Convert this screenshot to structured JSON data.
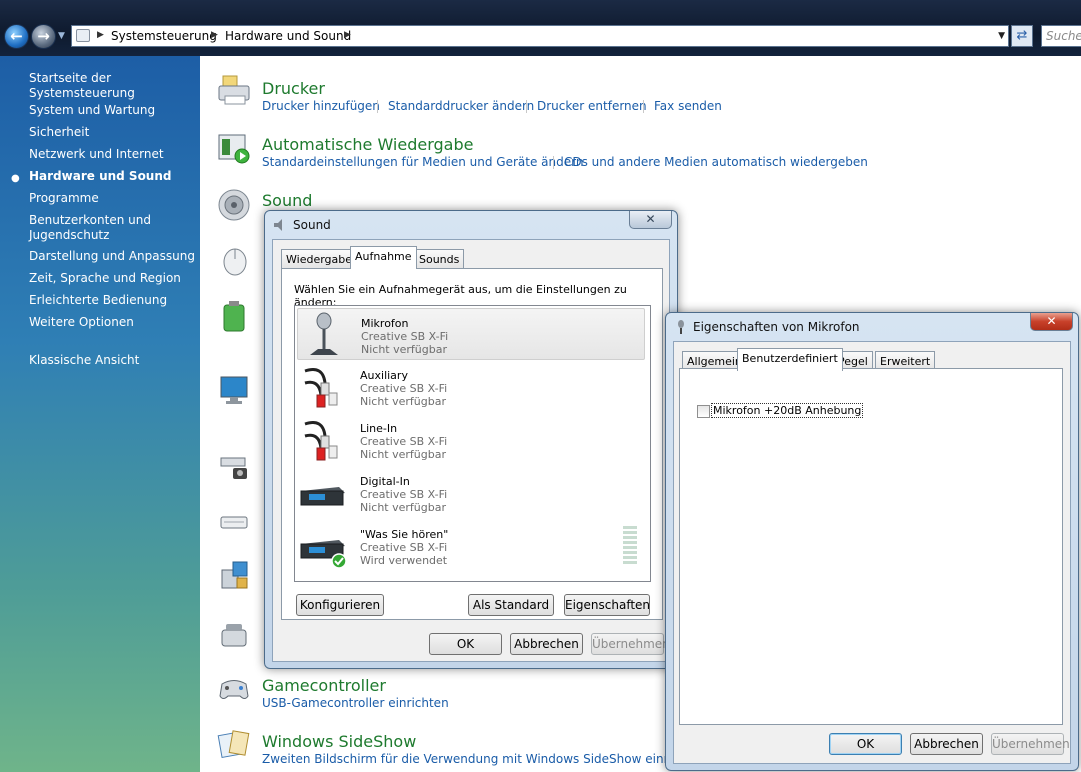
{
  "explorer": {
    "breadcrumb": [
      "Systemsteuerung",
      "Hardware und Sound"
    ],
    "search_placeholder": "Suchen"
  },
  "sidebar": {
    "items": [
      {
        "label": "Startseite der Systemsteuerung"
      },
      {
        "label": "System und Wartung"
      },
      {
        "label": "Sicherheit"
      },
      {
        "label": "Netzwerk und Internet"
      },
      {
        "label": "Hardware und Sound"
      },
      {
        "label": "Programme"
      },
      {
        "label": "Benutzerkonten und Jugendschutz"
      },
      {
        "label": "Darstellung und Anpassung"
      },
      {
        "label": "Zeit, Sprache und Region"
      },
      {
        "label": "Erleichterte Bedienung"
      },
      {
        "label": "Weitere Optionen"
      },
      {
        "label": "Klassische Ansicht"
      }
    ]
  },
  "categories": {
    "drucker": {
      "title": "Drucker",
      "links": [
        "Drucker hinzufügen",
        "Standarddrucker ändern",
        "Drucker entfernen",
        "Fax senden"
      ]
    },
    "autoplay": {
      "title": "Automatische Wiedergabe",
      "links": [
        "Standardeinstellungen für Medien und Geräte ändern",
        "CDs und andere Medien automatisch wiedergeben"
      ]
    },
    "sound": {
      "title": "Sound"
    },
    "gamecontroller": {
      "title": "Gamecontroller",
      "links": [
        "USB-Gamecontroller einrichten"
      ]
    },
    "sideshow": {
      "title": "Windows SideShow",
      "links": [
        "Zweiten Bildschirm für die Verwendung mit Windows SideShow einrichten"
      ]
    }
  },
  "sound_dialog": {
    "title": "Sound",
    "tabs": [
      "Wiedergabe",
      "Aufnahme",
      "Sounds"
    ],
    "instruction": "Wählen Sie ein Aufnahmegerät aus, um die Einstellungen zu ändern:",
    "devices": [
      {
        "name": "Mikrofon",
        "card": "Creative SB X-Fi",
        "status": "Nicht verfügbar"
      },
      {
        "name": "Auxiliary",
        "card": "Creative SB X-Fi",
        "status": "Nicht verfügbar"
      },
      {
        "name": "Line-In",
        "card": "Creative SB X-Fi",
        "status": "Nicht verfügbar"
      },
      {
        "name": "Digital-In",
        "card": "Creative SB X-Fi",
        "status": "Nicht verfügbar"
      },
      {
        "name": "\"Was Sie hören\"",
        "card": "Creative SB X-Fi",
        "status": "Wird verwendet"
      }
    ],
    "buttons": {
      "configure": "Konfigurieren",
      "default": "Als Standard",
      "properties": "Eigenschaften",
      "ok": "OK",
      "cancel": "Abbrechen",
      "apply": "Übernehmen"
    }
  },
  "mic_dialog": {
    "title": "Eigenschaften von Mikrofon",
    "tabs": [
      "Allgemein",
      "Benutzerdefiniert",
      "Pegel",
      "Erweitert"
    ],
    "checkbox_label": "Mikrofon +20dB Anhebung",
    "checkbox_checked": false,
    "buttons": {
      "ok": "OK",
      "cancel": "Abbrechen",
      "apply": "Übernehmen"
    }
  }
}
